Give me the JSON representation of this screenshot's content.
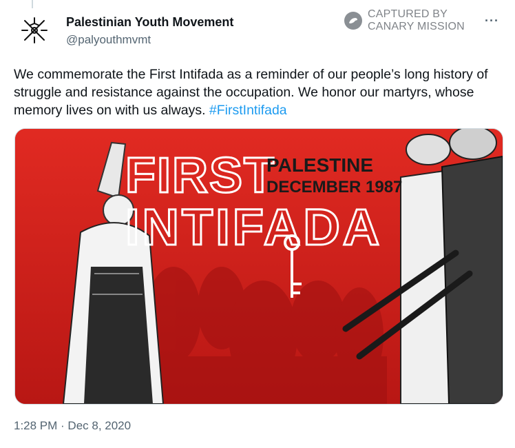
{
  "tweet": {
    "author_name": "Palestinian Youth Movement",
    "author_handle": "@palyouthmvmt",
    "text": "We commemorate the First Intifada as a reminder of our people’s long history of struggle and resistance against the occupation. We honor our martyrs, whose memory lives on with us always. ",
    "hashtag": "#FirstIntifada",
    "timestamp": "1:28 PM · Dec 8, 2020",
    "more_icon": "more-icon",
    "more_glyph": "···"
  },
  "watermark": {
    "line1": "CAPTURED BY",
    "line2": "CANARY MISSION",
    "icon": "canary-icon"
  },
  "media": {
    "title_line1": "FIRST",
    "title_line2": "INTIFADA",
    "subtitle_line1": "PALESTINE",
    "subtitle_line2": "DECEMBER 1987",
    "background_color": "#d8231f",
    "key_icon": "key-icon"
  },
  "colors": {
    "hashtag": "#1d9bf0",
    "secondary_text": "#536471"
  }
}
